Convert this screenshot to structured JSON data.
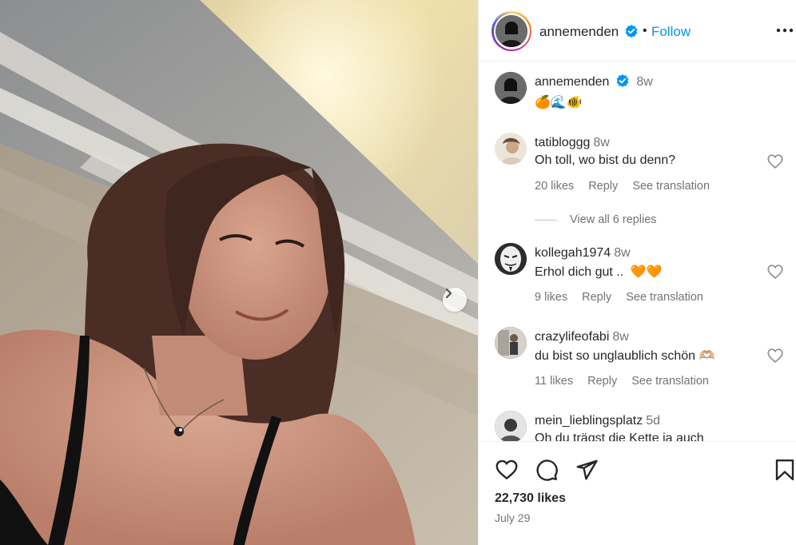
{
  "post": {
    "username": "annemenden",
    "follow_label": "Follow",
    "separator": "•",
    "likes": "22,730 likes",
    "date": "July 29",
    "photo_index": 0
  },
  "caption": {
    "username": "annemenden",
    "time": "8w",
    "emoji": "🍊🌊🐠"
  },
  "comments": [
    {
      "username": "tatibloggg",
      "time": "8w",
      "text": "Oh toll, wo bist du denn?",
      "likes": "20 likes",
      "reply": "Reply",
      "translate": "See translation"
    },
    {
      "username": "kollegah1974",
      "time": "8w",
      "text": "Erhol dich gut ..",
      "hearts": "🧡🧡",
      "likes": "9 likes",
      "reply": "Reply",
      "translate": "See translation"
    },
    {
      "username": "crazylifeofabi",
      "time": "8w",
      "text": "du bist so unglaublich schön 🫶🏼",
      "likes": "11 likes",
      "reply": "Reply",
      "translate": "See translation"
    },
    {
      "username": "mein_lieblingsplatz",
      "time": "5d",
      "text": "Oh du trägst die Kette ja auch"
    }
  ],
  "replies": {
    "view_all": "View all 6 replies"
  },
  "icons": {
    "verified": "verified-badge-icon",
    "more": "more-horizontal-icon",
    "like": "heart-icon",
    "comment": "comment-bubble-icon",
    "share": "paper-plane-icon",
    "save": "bookmark-icon",
    "next": "chevron-right-icon"
  },
  "colors": {
    "accent": "#0095f6",
    "verified": "#0095f6",
    "text": "#262626",
    "muted": "#737373",
    "border": "#efefef"
  }
}
